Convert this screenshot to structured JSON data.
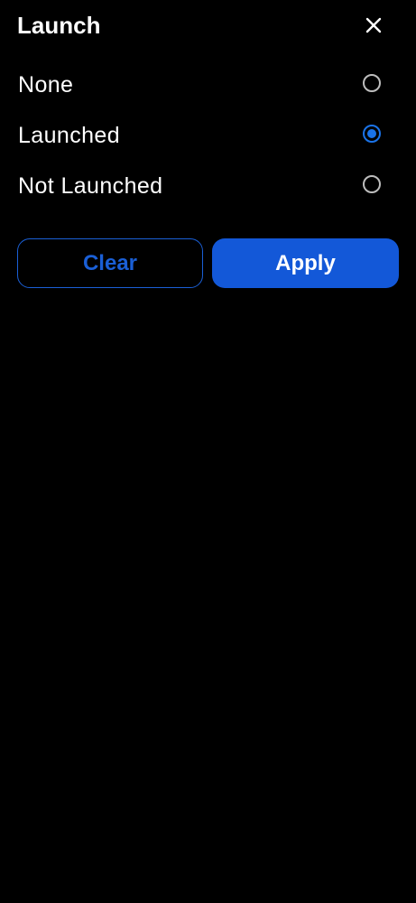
{
  "header": {
    "title": "Launch",
    "close_icon": "close-icon"
  },
  "options": [
    {
      "label": "None",
      "selected": false
    },
    {
      "label": "Launched",
      "selected": true
    },
    {
      "label": "Not Launched",
      "selected": false
    }
  ],
  "actions": {
    "clear_label": "Clear",
    "apply_label": "Apply"
  },
  "colors": {
    "background": "#000000",
    "accent": "#1a73e8",
    "apply_button": "#1358d8",
    "radio_unselected": "#bdbdbd",
    "text": "#ffffff"
  }
}
